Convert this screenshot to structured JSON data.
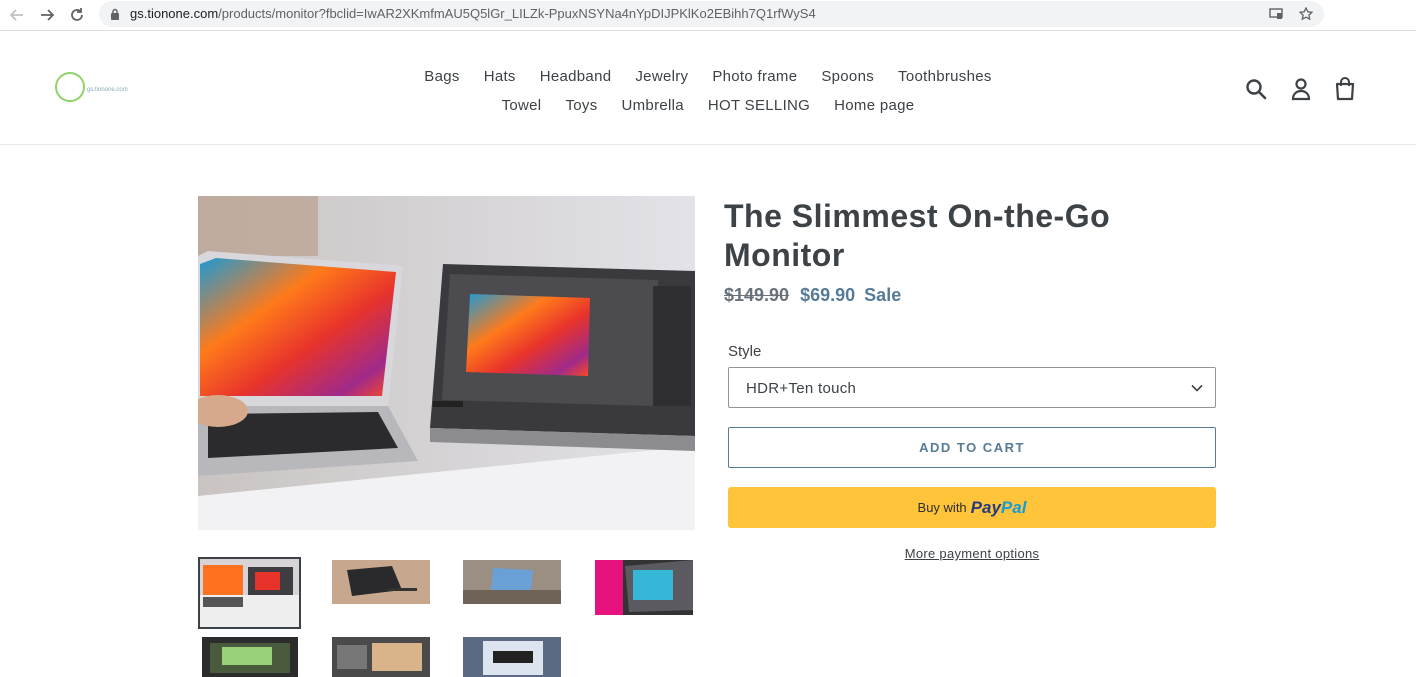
{
  "browser": {
    "url_host": "gs.tionone.com",
    "url_path": "/products/monitor?fbclid=IwAR2XKmfmAU5Q5lGr_LILZk-PpuxNSYNa4nYpDIJPKlKo2EBihh7Q1rfWyS4"
  },
  "header": {
    "logo_text": "gs.tionone.com",
    "nav_row1": [
      "Bags",
      "Hats",
      "Headband",
      "Jewelry",
      "Photo frame",
      "Spoons",
      "Toothbrushes"
    ],
    "nav_row2": [
      "Towel",
      "Toys",
      "Umbrella",
      "HOT SELLING",
      "Home page"
    ]
  },
  "product": {
    "title": "The Slimmest On-the-Go Monitor",
    "price_old": "$149.90",
    "price_new": "$69.90",
    "sale_label": "Sale",
    "style_label": "Style",
    "style_value": "HDR+Ten touch",
    "add_to_cart": "ADD TO CART",
    "paypal_prefix": "Buy with",
    "paypal_pay": "Pay",
    "paypal_pal": "Pal",
    "more_payment": "More payment options"
  },
  "colors": {
    "accent": "#557b97",
    "paypal": "#ffc439",
    "logo_green": "#8fd46a"
  }
}
